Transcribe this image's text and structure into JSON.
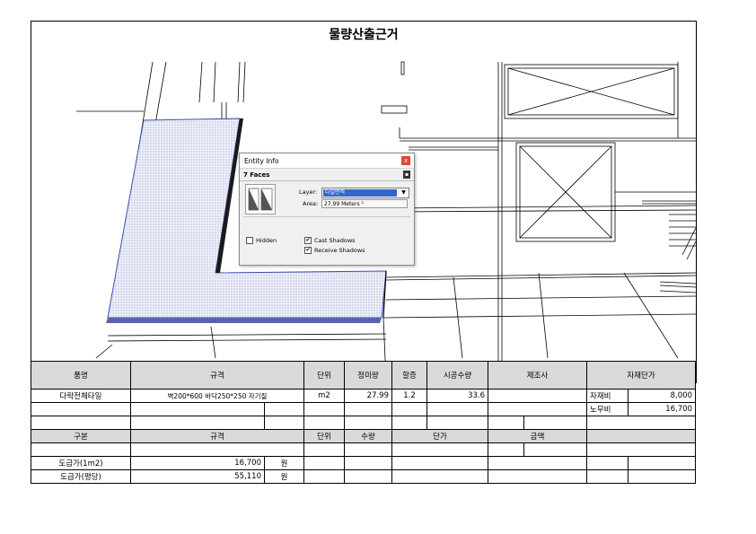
{
  "title": "물량산출근거",
  "entity_info": {
    "window_title": "Entity Info",
    "close_label": "x",
    "pin_label": "▪",
    "faces": "7 Faces",
    "layer_label": "Layer:",
    "layer_value": "타일면적",
    "area_label": "Area:",
    "area_value": "27.99 Meters ²",
    "hidden_label": "Hidden",
    "hidden_checked": false,
    "cast_shadows_label": "Cast Shadows",
    "cast_shadows_checked": true,
    "receive_shadows_label": "Receive Shadows",
    "receive_shadows_checked": true
  },
  "table": {
    "header1": {
      "item": "품명",
      "spec": "규격",
      "unit": "단위",
      "net_qty": "정미량",
      "rate": "할증",
      "work_qty": "시공수량",
      "maker": "제조사",
      "unit_price": "자재단가"
    },
    "row1": {
      "item": "다락전체타일",
      "spec": "벽200*600 바닥250*250 자기질",
      "unit": "m2",
      "net_qty": "27.99",
      "rate": "1.2",
      "work_qty": "33.6",
      "cost1_label": "자재비",
      "cost1_value": "8,000"
    },
    "row2": {
      "cost2_label": "노무비",
      "cost2_value": "16,700"
    },
    "header2": {
      "category": "구분",
      "spec": "규격",
      "unit": "단위",
      "qty": "수량",
      "price": "단가",
      "amount": "금액"
    },
    "row_a": {
      "label": "도급가(1m2)",
      "value": "16,700",
      "unit": "원"
    },
    "row_b": {
      "label": "도급가(평당)",
      "value": "55,110",
      "unit": "원"
    }
  }
}
